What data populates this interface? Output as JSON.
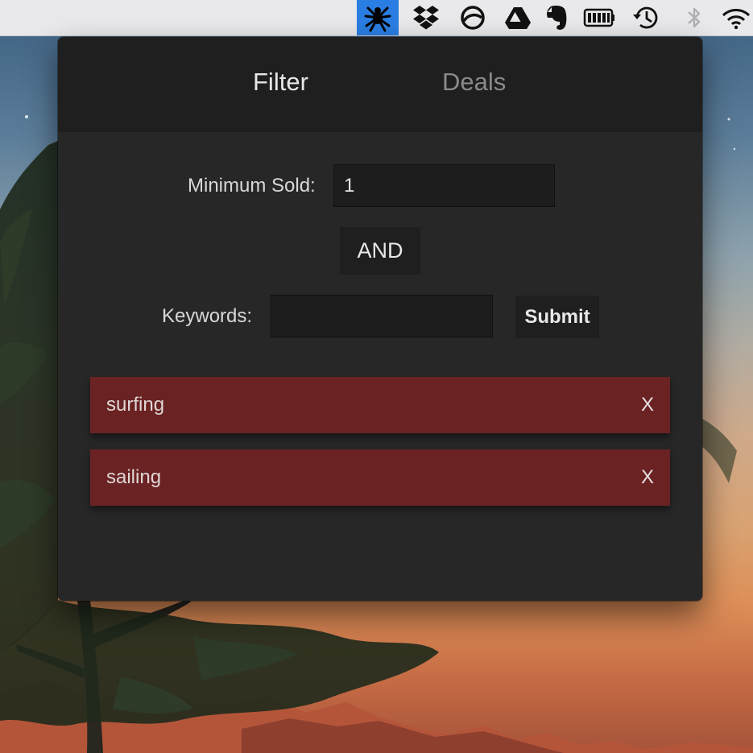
{
  "menubar": {
    "icons": [
      {
        "name": "spider-icon",
        "active": true
      },
      {
        "name": "dropbox-icon"
      },
      {
        "name": "circle-slash-icon"
      },
      {
        "name": "google-drive-icon"
      },
      {
        "name": "evernote-icon"
      },
      {
        "name": "battery-icon"
      },
      {
        "name": "time-machine-icon"
      },
      {
        "name": "bluetooth-icon"
      },
      {
        "name": "wifi-icon"
      }
    ],
    "active_color": "#2a7ee3"
  },
  "popover": {
    "tabs": [
      {
        "label": "Filter",
        "active": true
      },
      {
        "label": "Deals",
        "active": false
      }
    ],
    "filter": {
      "min_sold_label": "Minimum Sold:",
      "min_sold_value": "1",
      "operator_label": "AND",
      "keywords_label": "Keywords:",
      "keywords_value": "",
      "submit_label": "Submit"
    },
    "tags": [
      {
        "label": "surfing",
        "remove_label": "X"
      },
      {
        "label": "sailing",
        "remove_label": "X"
      }
    ],
    "tag_color": "#6a2222"
  }
}
